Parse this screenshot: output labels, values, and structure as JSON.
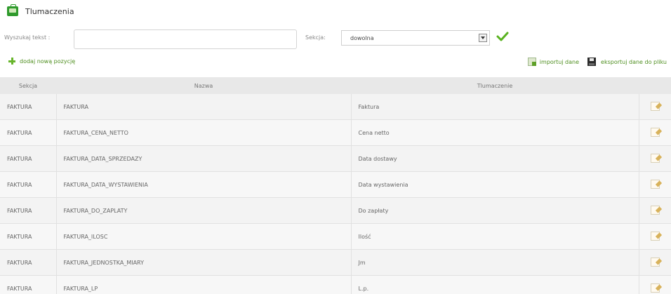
{
  "page": {
    "title": "Tlumaczenia"
  },
  "search": {
    "label": "Wyszukaj tekst :",
    "value": "",
    "placeholder": ""
  },
  "section_filter": {
    "label": "Sekcja:",
    "value": "dowolna"
  },
  "actions": {
    "add_new": "dodaj nową pozycję",
    "import": "importuj dane",
    "export": "eksportuj dane do pliku"
  },
  "table": {
    "headers": [
      "Sekcja",
      "Nazwa",
      "Tlumaczenie",
      ""
    ],
    "rows": [
      {
        "section": "FAKTURA",
        "name": "FAKTURA",
        "translation": "Faktura"
      },
      {
        "section": "FAKTURA",
        "name": "FAKTURA_CENA_NETTO",
        "translation": "Cena netto"
      },
      {
        "section": "FAKTURA",
        "name": "FAKTURA_DATA_SPRZEDAZY",
        "translation": "Data dostawy"
      },
      {
        "section": "FAKTURA",
        "name": "FAKTURA_DATA_WYSTAWIENIA",
        "translation": "Data wystawienia"
      },
      {
        "section": "FAKTURA",
        "name": "FAKTURA_DO_ZAPLATY",
        "translation": "Do zapłaty"
      },
      {
        "section": "FAKTURA",
        "name": "FAKTURA_ILOSC",
        "translation": "Ilość"
      },
      {
        "section": "FAKTURA",
        "name": "FAKTURA_JEDNOSTKA_MIARY",
        "translation": "Jm"
      },
      {
        "section": "FAKTURA",
        "name": "FAKTURA_LP",
        "translation": "L.p."
      }
    ]
  },
  "icons": {
    "page": "translation-icon",
    "confirm": "check-icon",
    "add": "plus-icon",
    "import": "import-icon",
    "export": "save-disk-icon",
    "edit": "edit-icon"
  },
  "colors": {
    "accent_green": "#4f8f20",
    "check_green": "#59b21f",
    "header_bg": "#e8e8e8",
    "row_bg": "#f3f3f3"
  }
}
